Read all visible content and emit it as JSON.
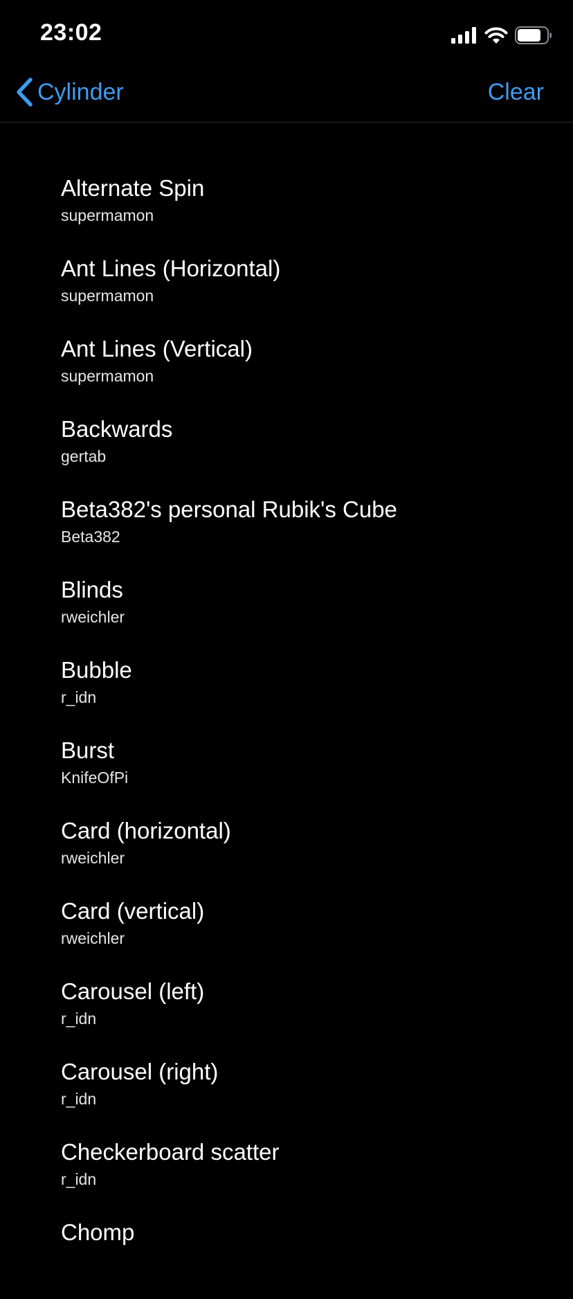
{
  "status_bar": {
    "time": "23:02",
    "icons": [
      "cellular-signal-icon",
      "wifi-icon",
      "battery-icon"
    ]
  },
  "nav": {
    "back_label": "Cylinder",
    "back_icon": "chevron-left-icon",
    "clear_label": "Clear",
    "accent_color": "#3f9bf0"
  },
  "effects": [
    {
      "title": "Alternate Spin",
      "author": "supermamon"
    },
    {
      "title": "Ant Lines (Horizontal)",
      "author": "supermamon"
    },
    {
      "title": "Ant Lines (Vertical)",
      "author": "supermamon"
    },
    {
      "title": "Backwards",
      "author": "gertab"
    },
    {
      "title": "Beta382's personal Rubik's Cube",
      "author": "Beta382"
    },
    {
      "title": "Blinds",
      "author": "rweichler"
    },
    {
      "title": "Bubble",
      "author": "r_idn"
    },
    {
      "title": "Burst",
      "author": "KnifeOfPi"
    },
    {
      "title": "Card (horizontal)",
      "author": "rweichler"
    },
    {
      "title": "Card (vertical)",
      "author": "rweichler"
    },
    {
      "title": "Carousel (left)",
      "author": "r_idn"
    },
    {
      "title": "Carousel (right)",
      "author": "r_idn"
    },
    {
      "title": "Checkerboard scatter",
      "author": "r_idn"
    },
    {
      "title": "Chomp",
      "author": ""
    }
  ]
}
